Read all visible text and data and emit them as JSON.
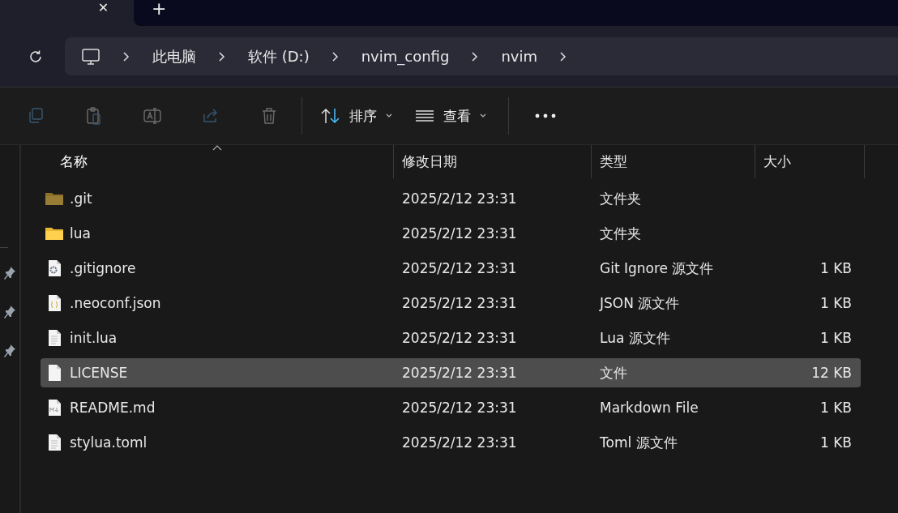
{
  "tab_strip": {
    "close_glyph": "✕",
    "new_tab_glyph": "+"
  },
  "address_bar": {
    "breadcrumbs": [
      "此电脑",
      "软件 (D:)",
      "nvim_config",
      "nvim"
    ]
  },
  "toolbar": {
    "icon_buttons": [
      {
        "kind": "copy",
        "disabled": true
      },
      {
        "kind": "paste",
        "disabled": true
      },
      {
        "kind": "rename",
        "disabled": true
      },
      {
        "kind": "share",
        "disabled": true
      },
      {
        "kind": "delete",
        "disabled": true
      }
    ],
    "menus": [
      {
        "kind": "sort",
        "label": "排序"
      },
      {
        "kind": "view",
        "label": "查看"
      }
    ]
  },
  "table": {
    "columns": [
      {
        "label": "名称",
        "sorted": true
      },
      {
        "label": "修改日期",
        "sorted": false
      },
      {
        "label": "类型",
        "sorted": false
      },
      {
        "label": "大小",
        "sorted": false
      }
    ],
    "rows": [
      {
        "kind": "folder-hidden",
        "name": ".git",
        "date": "2025/2/12 23:31",
        "type": "文件夹",
        "size": "",
        "selected": false
      },
      {
        "kind": "folder",
        "name": "lua",
        "date": "2025/2/12 23:31",
        "type": "文件夹",
        "size": "",
        "selected": false
      },
      {
        "kind": "gear-doc",
        "name": ".gitignore",
        "date": "2025/2/12 23:31",
        "type": "Git Ignore 源文件",
        "size": "1 KB",
        "selected": false
      },
      {
        "kind": "json-doc",
        "name": ".neoconf.json",
        "date": "2025/2/12 23:31",
        "type": "JSON 源文件",
        "size": "1 KB",
        "selected": false
      },
      {
        "kind": "text-doc",
        "name": "init.lua",
        "date": "2025/2/12 23:31",
        "type": "Lua 源文件",
        "size": "1 KB",
        "selected": false
      },
      {
        "kind": "blank-doc",
        "name": "LICENSE",
        "date": "2025/2/12 23:31",
        "type": "文件",
        "size": "12 KB",
        "selected": true
      },
      {
        "kind": "markdown-doc",
        "name": "README.md",
        "date": "2025/2/12 23:31",
        "type": "Markdown File",
        "size": "1 KB",
        "selected": false
      },
      {
        "kind": "text-doc",
        "name": "stylua.toml",
        "date": "2025/2/12 23:31",
        "type": "Toml 源文件",
        "size": "1 KB",
        "selected": false
      }
    ]
  }
}
